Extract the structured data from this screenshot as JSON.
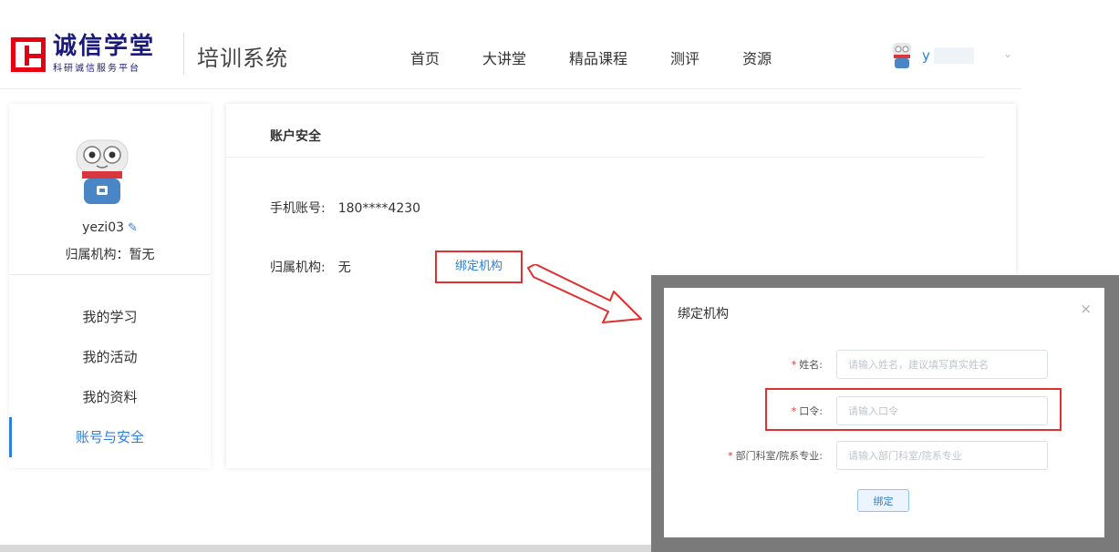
{
  "header": {
    "logo_title": "诚信学堂",
    "logo_subtitle": "科研诚信服务平台",
    "system_name": "培训系统",
    "nav": [
      "首页",
      "大讲堂",
      "精品课程",
      "测评",
      "资源"
    ],
    "user_initial": "y"
  },
  "sidebar": {
    "username": "yezi03",
    "org_label": "归属机构：暂无",
    "menu": [
      {
        "label": "我的学习"
      },
      {
        "label": "我的活动"
      },
      {
        "label": "我的资料"
      },
      {
        "label": "账号与安全",
        "active": true
      }
    ]
  },
  "main": {
    "title": "账户安全",
    "phone_label": "手机账号:",
    "phone_value": "180****4230",
    "org_label": "归属机构:",
    "org_value": "无",
    "bind_link": "绑定机构"
  },
  "modal": {
    "title": "绑定机构",
    "close": "×",
    "fields": [
      {
        "label": "姓名:",
        "placeholder": "请输入姓名，建议填写真实姓名"
      },
      {
        "label": "口令:",
        "placeholder": "请输入口令"
      },
      {
        "label": "部门科室/院系专业:",
        "placeholder": "请输入部门科室/院系专业"
      }
    ],
    "required_mark": "*",
    "submit": "绑定"
  },
  "colors": {
    "brand_red": "#e60012",
    "brand_navy": "#1a1a7a",
    "link_blue": "#2f7fd6",
    "highlight_red": "#e03030"
  }
}
